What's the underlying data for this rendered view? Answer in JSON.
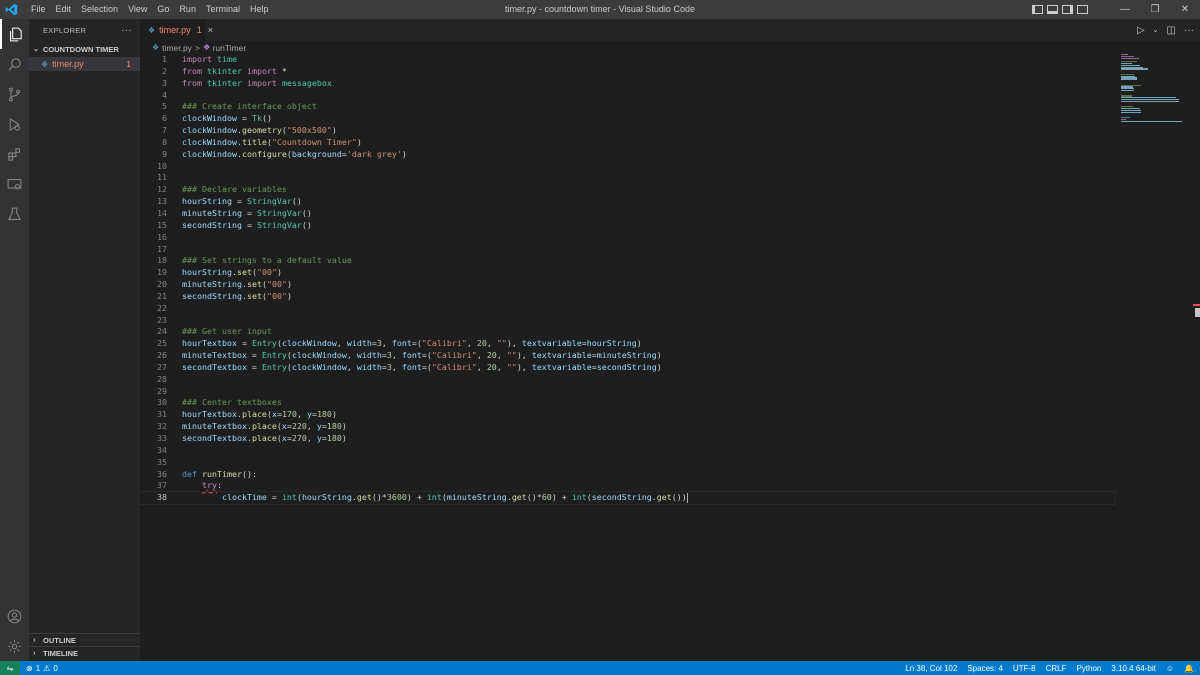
{
  "window": {
    "title": "timer.py - countdown timer - Visual Studio Code",
    "menu": [
      "File",
      "Edit",
      "Selection",
      "View",
      "Go",
      "Run",
      "Terminal",
      "Help"
    ]
  },
  "sidebar": {
    "header": "EXPLORER",
    "more": "···",
    "folder": "COUNTDOWN TIMER",
    "file": {
      "name": "timer.py",
      "problems": "1"
    },
    "outline": "OUTLINE",
    "timeline": "TIMELINE"
  },
  "editor": {
    "tab": {
      "name": "timer.py",
      "problems": "1",
      "close": "×"
    },
    "breadcrumb": {
      "file": "timer.py",
      "separator": ">",
      "symbol": "runTimer"
    },
    "active_line": 38,
    "lines": [
      [
        [
          "kw",
          "import"
        ],
        [
          "op",
          " "
        ],
        [
          "mod",
          "time"
        ]
      ],
      [
        [
          "kw",
          "from"
        ],
        [
          "op",
          " "
        ],
        [
          "mod",
          "tkinter"
        ],
        [
          "op",
          " "
        ],
        [
          "kw",
          "import"
        ],
        [
          "op",
          " *"
        ]
      ],
      [
        [
          "kw",
          "from"
        ],
        [
          "op",
          " "
        ],
        [
          "mod",
          "tkinter"
        ],
        [
          "op",
          " "
        ],
        [
          "kw",
          "import"
        ],
        [
          "op",
          " "
        ],
        [
          "mod",
          "messagebox"
        ]
      ],
      [],
      [
        [
          "cm",
          "### Create interface object"
        ]
      ],
      [
        [
          "var",
          "clockWindow"
        ],
        [
          "op",
          " = "
        ],
        [
          "cls",
          "Tk"
        ],
        [
          "op",
          "()"
        ]
      ],
      [
        [
          "var",
          "clockWindow"
        ],
        [
          "op",
          "."
        ],
        [
          "fn",
          "geometry"
        ],
        [
          "op",
          "("
        ],
        [
          "str",
          "\"500x500\""
        ],
        [
          "op",
          ")"
        ]
      ],
      [
        [
          "var",
          "clockWindow"
        ],
        [
          "op",
          "."
        ],
        [
          "fn",
          "title"
        ],
        [
          "op",
          "("
        ],
        [
          "str",
          "\"Countdown Timer\""
        ],
        [
          "op",
          ")"
        ]
      ],
      [
        [
          "var",
          "clockWindow"
        ],
        [
          "op",
          "."
        ],
        [
          "fn",
          "configure"
        ],
        [
          "op",
          "("
        ],
        [
          "var",
          "background"
        ],
        [
          "op",
          "="
        ],
        [
          "str",
          "'dark grey'"
        ],
        [
          "op",
          ")"
        ]
      ],
      [],
      [],
      [
        [
          "cm",
          "### Declare variables"
        ]
      ],
      [
        [
          "var",
          "hourString"
        ],
        [
          "op",
          " = "
        ],
        [
          "cls",
          "StringVar"
        ],
        [
          "op",
          "()"
        ]
      ],
      [
        [
          "var",
          "minuteString"
        ],
        [
          "op",
          " = "
        ],
        [
          "cls",
          "StringVar"
        ],
        [
          "op",
          "()"
        ]
      ],
      [
        [
          "var",
          "secondString"
        ],
        [
          "op",
          " = "
        ],
        [
          "cls",
          "StringVar"
        ],
        [
          "op",
          "()"
        ]
      ],
      [],
      [],
      [
        [
          "cm",
          "### Set strings to a default value"
        ]
      ],
      [
        [
          "var",
          "hourString"
        ],
        [
          "op",
          "."
        ],
        [
          "fn",
          "set"
        ],
        [
          "op",
          "("
        ],
        [
          "str",
          "\"00\""
        ],
        [
          "op",
          ")"
        ]
      ],
      [
        [
          "var",
          "minuteString"
        ],
        [
          "op",
          "."
        ],
        [
          "fn",
          "set"
        ],
        [
          "op",
          "("
        ],
        [
          "str",
          "\"00\""
        ],
        [
          "op",
          ")"
        ]
      ],
      [
        [
          "var",
          "secondString"
        ],
        [
          "op",
          "."
        ],
        [
          "fn",
          "set"
        ],
        [
          "op",
          "("
        ],
        [
          "str",
          "\"00\""
        ],
        [
          "op",
          ")"
        ]
      ],
      [],
      [],
      [
        [
          "cm",
          "### Get user input"
        ]
      ],
      [
        [
          "var",
          "hourTextbox"
        ],
        [
          "op",
          " = "
        ],
        [
          "cls",
          "Entry"
        ],
        [
          "op",
          "("
        ],
        [
          "var",
          "clockWindow"
        ],
        [
          "op",
          ", "
        ],
        [
          "var",
          "width"
        ],
        [
          "op",
          "="
        ],
        [
          "num",
          "3"
        ],
        [
          "op",
          ", "
        ],
        [
          "var",
          "font"
        ],
        [
          "op",
          "=("
        ],
        [
          "str",
          "\"Calibri\""
        ],
        [
          "op",
          ", "
        ],
        [
          "num",
          "20"
        ],
        [
          "op",
          ", "
        ],
        [
          "str",
          "\"\""
        ],
        [
          "op",
          "), "
        ],
        [
          "var",
          "textvariable"
        ],
        [
          "op",
          "="
        ],
        [
          "var",
          "hourString"
        ],
        [
          "op",
          ")"
        ]
      ],
      [
        [
          "var",
          "minuteTextbox"
        ],
        [
          "op",
          " = "
        ],
        [
          "cls",
          "Entry"
        ],
        [
          "op",
          "("
        ],
        [
          "var",
          "clockWindow"
        ],
        [
          "op",
          ", "
        ],
        [
          "var",
          "width"
        ],
        [
          "op",
          "="
        ],
        [
          "num",
          "3"
        ],
        [
          "op",
          ", "
        ],
        [
          "var",
          "font"
        ],
        [
          "op",
          "=("
        ],
        [
          "str",
          "\"Calibri\""
        ],
        [
          "op",
          ", "
        ],
        [
          "num",
          "20"
        ],
        [
          "op",
          ", "
        ],
        [
          "str",
          "\"\""
        ],
        [
          "op",
          "), "
        ],
        [
          "var",
          "textvariable"
        ],
        [
          "op",
          "="
        ],
        [
          "var",
          "minuteString"
        ],
        [
          "op",
          ")"
        ]
      ],
      [
        [
          "var",
          "secondTextbox"
        ],
        [
          "op",
          " = "
        ],
        [
          "cls",
          "Entry"
        ],
        [
          "op",
          "("
        ],
        [
          "var",
          "clockWindow"
        ],
        [
          "op",
          ", "
        ],
        [
          "var",
          "width"
        ],
        [
          "op",
          "="
        ],
        [
          "num",
          "3"
        ],
        [
          "op",
          ", "
        ],
        [
          "var",
          "font"
        ],
        [
          "op",
          "=("
        ],
        [
          "str",
          "\"Calibri\""
        ],
        [
          "op",
          ", "
        ],
        [
          "num",
          "20"
        ],
        [
          "op",
          ", "
        ],
        [
          "str",
          "\"\""
        ],
        [
          "op",
          "), "
        ],
        [
          "var",
          "textvariable"
        ],
        [
          "op",
          "="
        ],
        [
          "var",
          "secondString"
        ],
        [
          "op",
          ")"
        ]
      ],
      [],
      [],
      [
        [
          "cm",
          "### Center textboxes"
        ]
      ],
      [
        [
          "var",
          "hourTextbox"
        ],
        [
          "op",
          "."
        ],
        [
          "fn",
          "place"
        ],
        [
          "op",
          "("
        ],
        [
          "var",
          "x"
        ],
        [
          "op",
          "="
        ],
        [
          "num",
          "170"
        ],
        [
          "op",
          ", "
        ],
        [
          "var",
          "y"
        ],
        [
          "op",
          "="
        ],
        [
          "num",
          "180"
        ],
        [
          "op",
          ")"
        ]
      ],
      [
        [
          "var",
          "minuteTextbox"
        ],
        [
          "op",
          "."
        ],
        [
          "fn",
          "place"
        ],
        [
          "op",
          "("
        ],
        [
          "var",
          "x"
        ],
        [
          "op",
          "="
        ],
        [
          "num",
          "220"
        ],
        [
          "op",
          ", "
        ],
        [
          "var",
          "y"
        ],
        [
          "op",
          "="
        ],
        [
          "num",
          "180"
        ],
        [
          "op",
          ")"
        ]
      ],
      [
        [
          "var",
          "secondTextbox"
        ],
        [
          "op",
          "."
        ],
        [
          "fn",
          "place"
        ],
        [
          "op",
          "("
        ],
        [
          "var",
          "x"
        ],
        [
          "op",
          "="
        ],
        [
          "num",
          "270"
        ],
        [
          "op",
          ", "
        ],
        [
          "var",
          "y"
        ],
        [
          "op",
          "="
        ],
        [
          "num",
          "180"
        ],
        [
          "op",
          ")"
        ]
      ],
      [],
      [],
      [
        [
          "def",
          "def"
        ],
        [
          "op",
          " "
        ],
        [
          "fn",
          "runTimer"
        ],
        [
          "op",
          "():"
        ]
      ],
      [
        [
          "op",
          "    "
        ],
        [
          "try",
          "try"
        ],
        [
          "op",
          ":"
        ]
      ],
      [
        [
          "op",
          "        "
        ],
        [
          "var",
          "clockTime"
        ],
        [
          "op",
          " = "
        ],
        [
          "cls",
          "int"
        ],
        [
          "op",
          "("
        ],
        [
          "var",
          "hourString"
        ],
        [
          "op",
          "."
        ],
        [
          "fn",
          "get"
        ],
        [
          "op",
          "()*"
        ],
        [
          "num",
          "3600"
        ],
        [
          "op",
          ") + "
        ],
        [
          "cls",
          "int"
        ],
        [
          "op",
          "("
        ],
        [
          "var",
          "minuteString"
        ],
        [
          "op",
          "."
        ],
        [
          "fn",
          "get"
        ],
        [
          "op",
          "()*"
        ],
        [
          "num",
          "60"
        ],
        [
          "op",
          ") + "
        ],
        [
          "cls",
          "int"
        ],
        [
          "op",
          "("
        ],
        [
          "var",
          "secondString"
        ],
        [
          "op",
          "."
        ],
        [
          "fn",
          "get"
        ],
        [
          "op",
          "())"
        ]
      ]
    ]
  },
  "statusbar": {
    "errors": "1",
    "warnings": "0",
    "position": "Ln 38, Col 102",
    "spaces": "Spaces: 4",
    "encoding": "UTF-8",
    "eol": "CRLF",
    "language": "Python",
    "interpreter": "3.10.4 64-bit"
  },
  "colors": {
    "accent": "#007acc",
    "remote": "#16825d",
    "error": "#f48771"
  }
}
